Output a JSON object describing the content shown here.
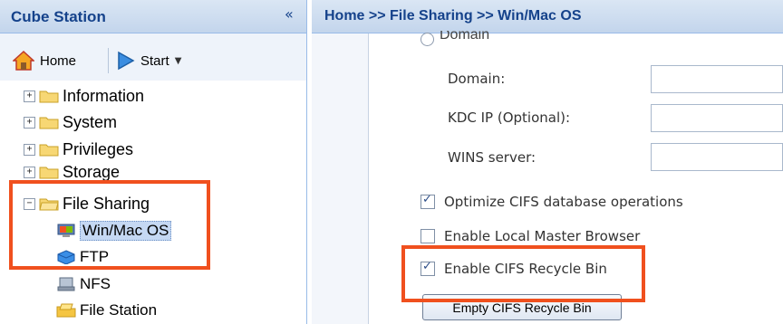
{
  "sidebar": {
    "title": "Cube Station",
    "collapse_glyph": "«",
    "toolbar": {
      "home": "Home",
      "start": "Start"
    },
    "tree": [
      {
        "label": "Information",
        "expander": "+"
      },
      {
        "label": "System",
        "expander": "+"
      },
      {
        "label": "Privileges",
        "expander": "+"
      },
      {
        "label": "Storage",
        "expander": "+"
      },
      {
        "label": "File Sharing",
        "expander": "−"
      }
    ],
    "children": [
      {
        "label": "Win/Mac OS",
        "icon": "windows-mac-icon"
      },
      {
        "label": "FTP",
        "icon": "ftp-icon"
      },
      {
        "label": "NFS",
        "icon": "nfs-icon"
      },
      {
        "label": "File Station",
        "icon": "file-station-icon"
      }
    ]
  },
  "main": {
    "breadcrumb": "Home >> File Sharing >> Win/Mac OS",
    "radio_domain": "Domain",
    "fields": [
      {
        "label": "Domain:",
        "value": ""
      },
      {
        "label": "KDC IP (Optional):",
        "value": ""
      },
      {
        "label": "WINS server:",
        "value": ""
      }
    ],
    "checkboxes": [
      {
        "label": "Optimize CIFS database operations",
        "checked": true
      },
      {
        "label": "Enable Local Master Browser",
        "checked": false
      },
      {
        "label": "Enable CIFS Recycle Bin",
        "checked": true
      }
    ],
    "empty_button": "Empty CIFS Recycle Bin"
  },
  "colors": {
    "header": "#c3d5ec",
    "title_text": "#15428b",
    "highlight": "#f0501e",
    "selection": "#c5d8f3"
  }
}
